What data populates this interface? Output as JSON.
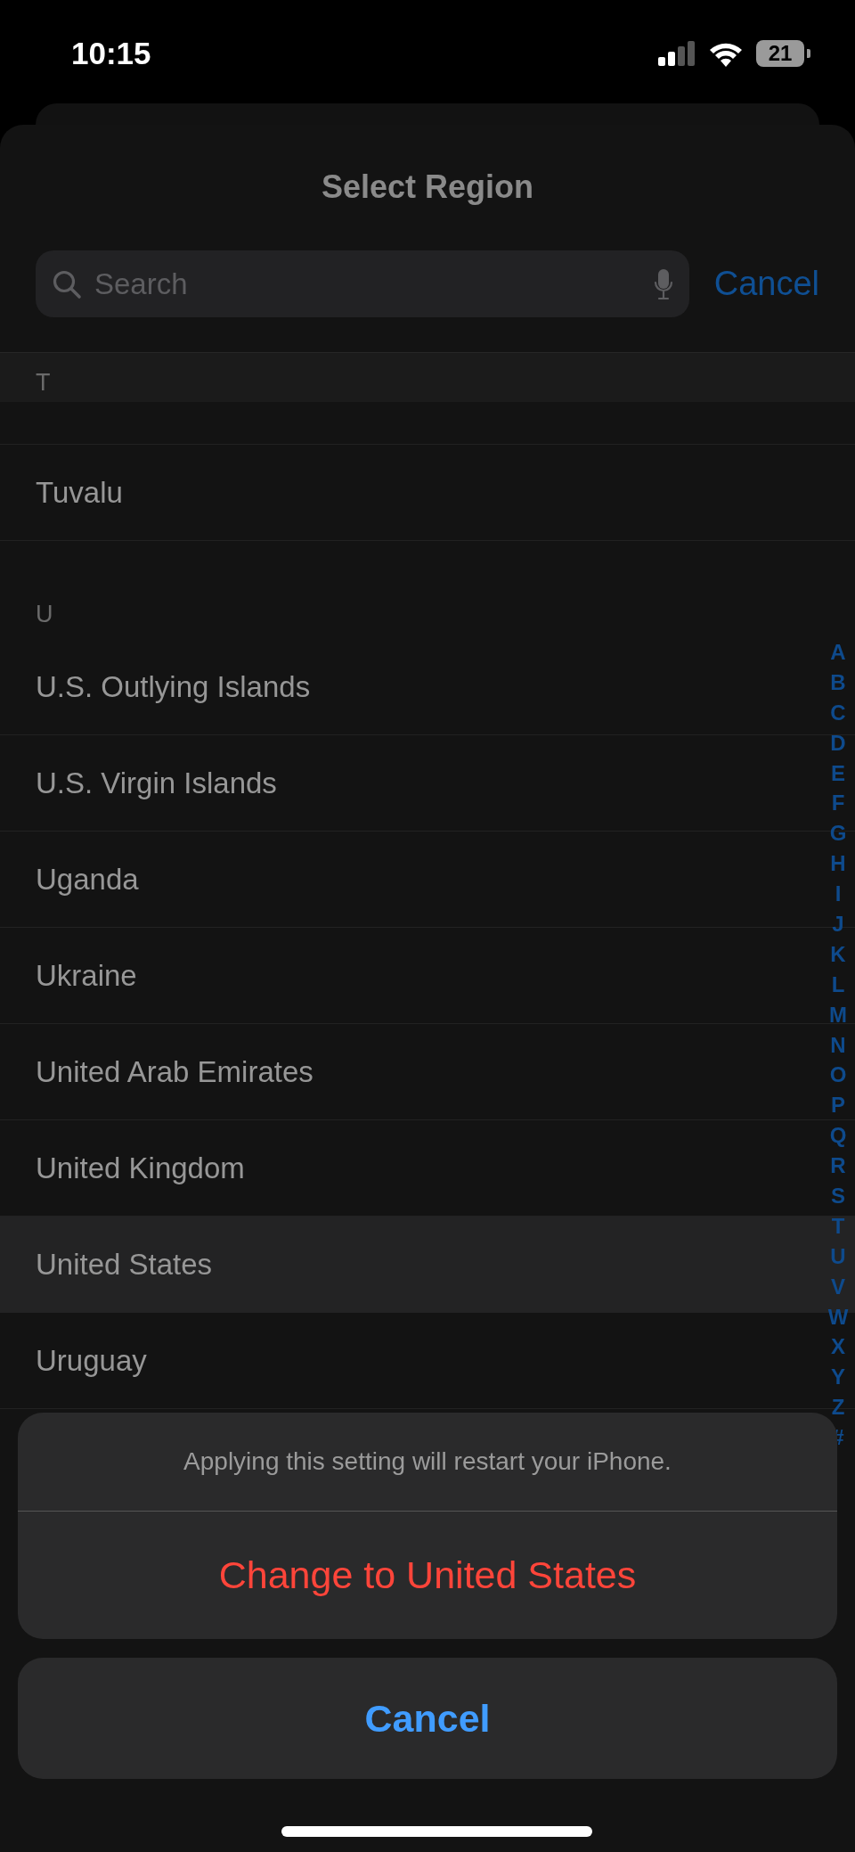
{
  "status_bar": {
    "time": "10:15",
    "battery": "21"
  },
  "title": "Select Region",
  "search": {
    "placeholder": "Search"
  },
  "cancel": "Cancel",
  "sections": [
    {
      "header": "T",
      "items": [
        {
          "name": "Tuvalu",
          "selected": false
        }
      ]
    },
    {
      "header": "U",
      "items": [
        {
          "name": "U.S. Outlying Islands",
          "selected": false
        },
        {
          "name": "U.S. Virgin Islands",
          "selected": false
        },
        {
          "name": "Uganda",
          "selected": false
        },
        {
          "name": "Ukraine",
          "selected": false
        },
        {
          "name": "United Arab Emirates",
          "selected": false
        },
        {
          "name": "United Kingdom",
          "selected": false
        },
        {
          "name": "United States",
          "selected": true
        },
        {
          "name": "Uruguay",
          "selected": false
        }
      ]
    }
  ],
  "index": [
    "A",
    "B",
    "C",
    "D",
    "E",
    "F",
    "G",
    "H",
    "I",
    "J",
    "K",
    "L",
    "M",
    "N",
    "O",
    "P",
    "Q",
    "R",
    "S",
    "T",
    "U",
    "V",
    "W",
    "X",
    "Y",
    "Z",
    "#"
  ],
  "action_sheet": {
    "message": "Applying this setting will restart your iPhone.",
    "action": "Change to United States",
    "cancel": "Cancel"
  }
}
